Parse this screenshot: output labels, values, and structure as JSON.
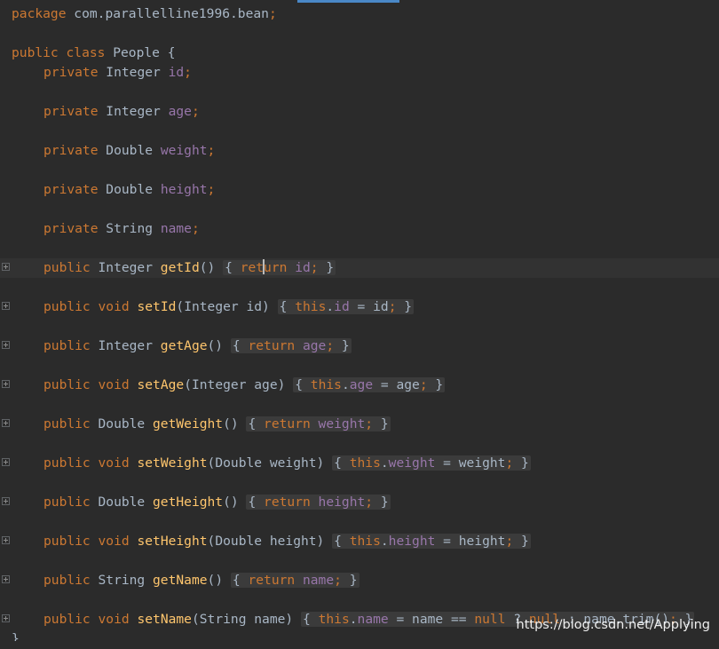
{
  "editor": {
    "package_line": {
      "keyword": "package",
      "name": " com.parallelline1996.bean",
      "semi": ";"
    },
    "class_line": {
      "k1": "public",
      "k2": "class",
      "name": " People {"
    },
    "fields": [
      {
        "mod": "private",
        "type": " Integer ",
        "name": "id",
        "semi": ";"
      },
      {
        "mod": "private",
        "type": " Integer ",
        "name": "age",
        "semi": ";"
      },
      {
        "mod": "private",
        "type": " Double ",
        "name": "weight",
        "semi": ";"
      },
      {
        "mod": "private",
        "type": " Double ",
        "name": "height",
        "semi": ";"
      },
      {
        "mod": "private",
        "type": " String ",
        "name": "name",
        "semi": ";"
      }
    ],
    "getId": {
      "mod": "public",
      "ret": " Integer ",
      "name": "getId",
      "parens": "()",
      "open": "{ ",
      "ret_a": "ret",
      "ret_b": "urn",
      "field": " id",
      "semi": ";",
      "close": " }"
    },
    "setId": {
      "mod": "public",
      "void": "void",
      "name": "setId",
      "args": "(Integer id)",
      "open": "{ ",
      "this": "this",
      "dot": ".",
      "field": "id",
      "assign": " = id",
      "semi": ";",
      "close": " }"
    },
    "getAge": {
      "mod": "public",
      "ret": " Integer ",
      "name": "getAge",
      "parens": "()",
      "open": "{ ",
      "kw": "return",
      "field": " age",
      "semi": ";",
      "close": " }"
    },
    "setAge": {
      "mod": "public",
      "void": "void",
      "name": "setAge",
      "args": "(Integer age)",
      "open": "{ ",
      "this": "this",
      "dot": ".",
      "field": "age",
      "assign": " = age",
      "semi": ";",
      "close": " }"
    },
    "getWeight": {
      "mod": "public",
      "ret": " Double ",
      "name": "getWeight",
      "parens": "()",
      "open": "{ ",
      "kw": "return",
      "field": " weight",
      "semi": ";",
      "close": " }"
    },
    "setWeight": {
      "mod": "public",
      "void": "void",
      "name": "setWeight",
      "args": "(Double weight)",
      "open": "{ ",
      "this": "this",
      "dot": ".",
      "field": "weight",
      "assign": " = weight",
      "semi": ";",
      "close": " }"
    },
    "getHeight": {
      "mod": "public",
      "ret": " Double ",
      "name": "getHeight",
      "parens": "()",
      "open": "{ ",
      "kw": "return",
      "field": " height",
      "semi": ";",
      "close": " }"
    },
    "setHeight": {
      "mod": "public",
      "void": "void",
      "name": "setHeight",
      "args": "(Double height)",
      "open": "{ ",
      "this": "this",
      "dot": ".",
      "field": "height",
      "assign": " = height",
      "semi": ";",
      "close": " }"
    },
    "getName": {
      "mod": "public",
      "ret": " String ",
      "name": "getName",
      "parens": "()",
      "open": "{ ",
      "kw": "return",
      "field": " name",
      "semi": ";",
      "close": " }"
    },
    "setName": {
      "mod": "public",
      "void": "void",
      "name": "setName",
      "args": "(String name)",
      "open": "{ ",
      "this": "this",
      "dot": ".",
      "field": "name",
      "assign": " = name == ",
      "null1": "null",
      "tern": " ? ",
      "null2": "null",
      "colon": " : name.trim()",
      "semi": ";",
      "close": " }"
    },
    "class_close": "}"
  },
  "watermark": "https://blog.csdn.net/Applying",
  "colors": {
    "background": "#2b2b2b",
    "keyword": "#cc7832",
    "field": "#9876aa",
    "method": "#ffc66d",
    "plain": "#a9b7c6",
    "fold_box": "#3b3b3b"
  }
}
